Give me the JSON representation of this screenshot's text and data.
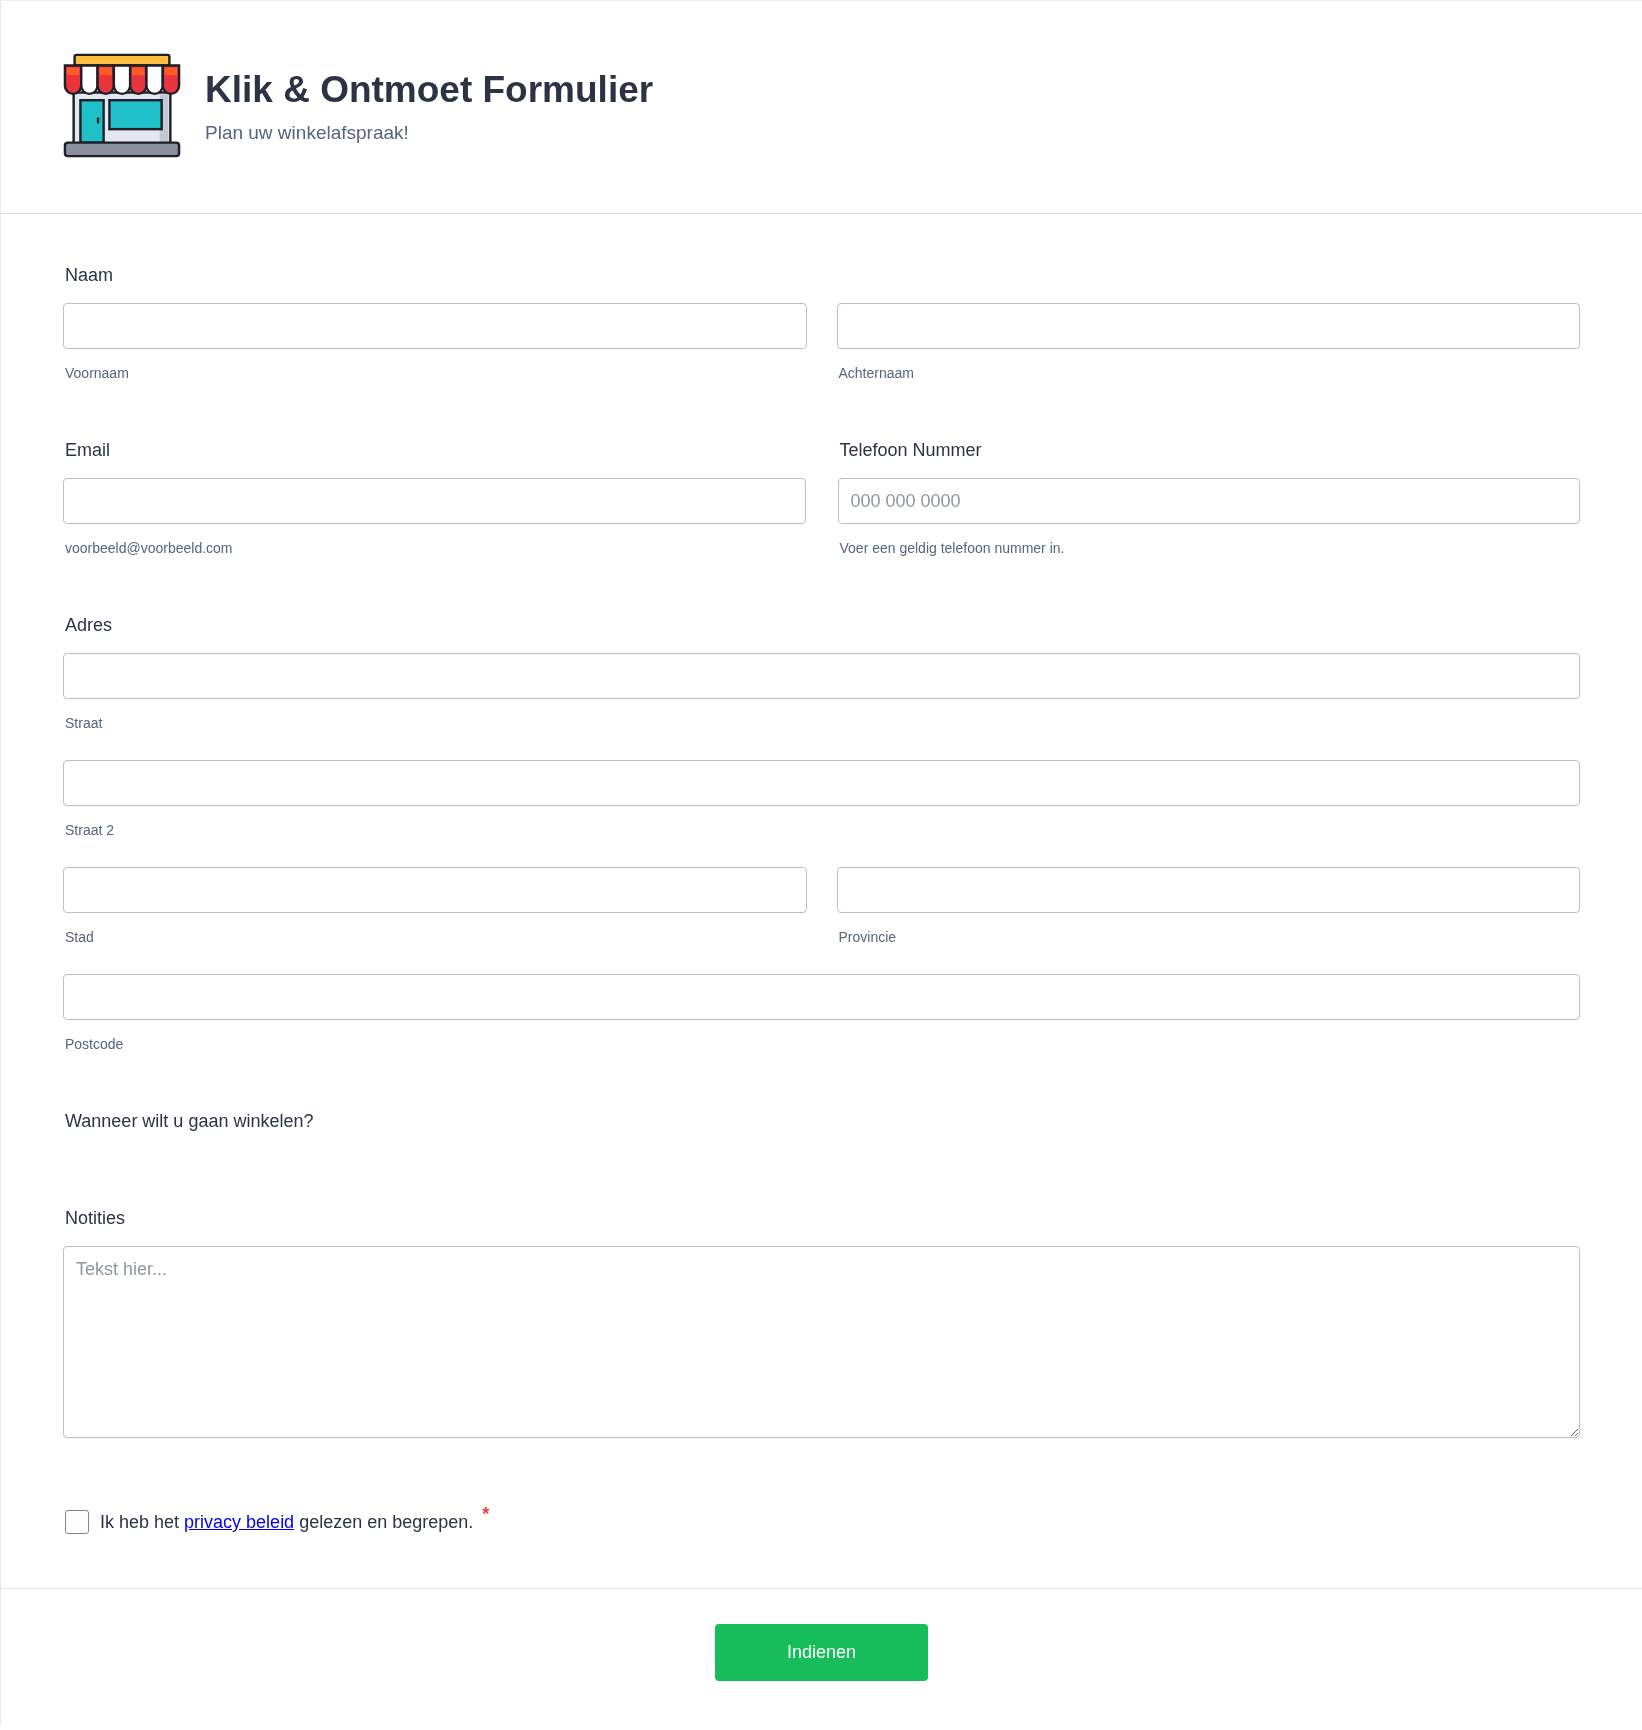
{
  "header": {
    "title": "Klik & Ontmoet Formulier",
    "subtitle": "Plan uw winkelafspraak!"
  },
  "sections": [
    {
      "kind": "group",
      "label": "Naam",
      "lines": [
        [
          {
            "sublabel": "Voornaam"
          },
          {
            "sublabel": "Achternaam"
          }
        ]
      ]
    },
    {
      "kind": "pair",
      "items": [
        {
          "label": "Email",
          "sublabel": "voorbeeld@voorbeeld.com"
        },
        {
          "label": "Telefoon Nummer",
          "placeholder": "000 000 0000",
          "sublabel": "Voer een geldig telefoon nummer in."
        }
      ]
    },
    {
      "kind": "group",
      "label": "Adres",
      "lines": [
        [
          {
            "sublabel": "Straat"
          }
        ],
        [
          {
            "sublabel": "Straat 2"
          }
        ],
        [
          {
            "sublabel": "Stad"
          },
          {
            "sublabel": "Provincie"
          }
        ],
        [
          {
            "sublabel": "Postcode"
          }
        ]
      ]
    },
    {
      "kind": "question",
      "label": "Wanneer wilt u gaan winkelen?"
    },
    {
      "kind": "textarea",
      "label": "Notities",
      "placeholder": "Tekst hier..."
    },
    {
      "kind": "consent",
      "checked": false,
      "text_before": "Ik heb het",
      "link": "privacy beleid",
      "text_after": "gelezen en begrepen.",
      "required_mark": "*"
    }
  ],
  "submit": {
    "label": "Indienen"
  }
}
